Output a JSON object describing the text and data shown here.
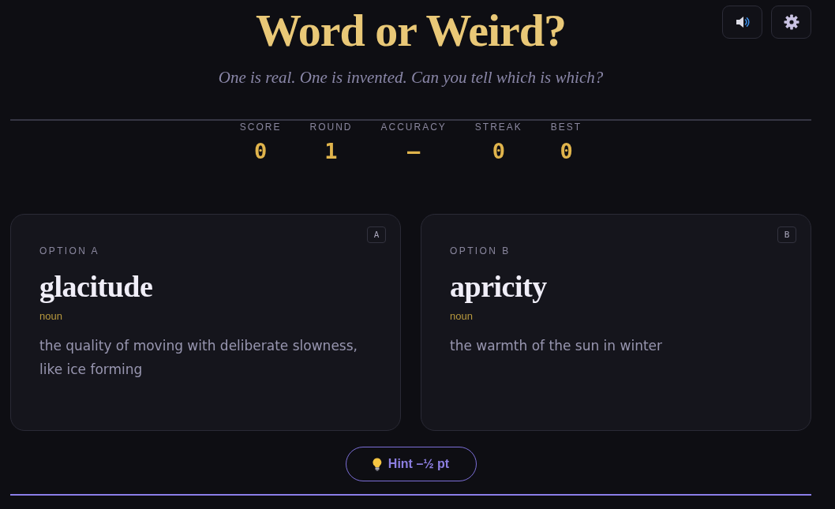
{
  "header": {
    "title": "Word or Weird?",
    "subtitle": "One is real. One is invented. Can you tell which is which?"
  },
  "toolbar": [
    {
      "kind": "sound"
    },
    {
      "kind": "settings"
    }
  ],
  "stats": [
    {
      "label": "SCORE",
      "value": "0"
    },
    {
      "label": "ROUND",
      "value": "1"
    },
    {
      "label": "ACCURACY",
      "value": "—"
    },
    {
      "label": "STREAK",
      "value": "0"
    },
    {
      "label": "BEST",
      "value": "0"
    }
  ],
  "options": [
    {
      "label": "OPTION A",
      "key": "A",
      "word": "glacitude",
      "part_of_speech": "noun",
      "definition": "the quality of moving with deliberate slowness, like ice forming"
    },
    {
      "label": "OPTION B",
      "key": "B",
      "word": "apricity",
      "part_of_speech": "noun",
      "definition": "the warmth of the sun in winter"
    }
  ],
  "hint_button": {
    "label": "Hint –½ pt"
  }
}
